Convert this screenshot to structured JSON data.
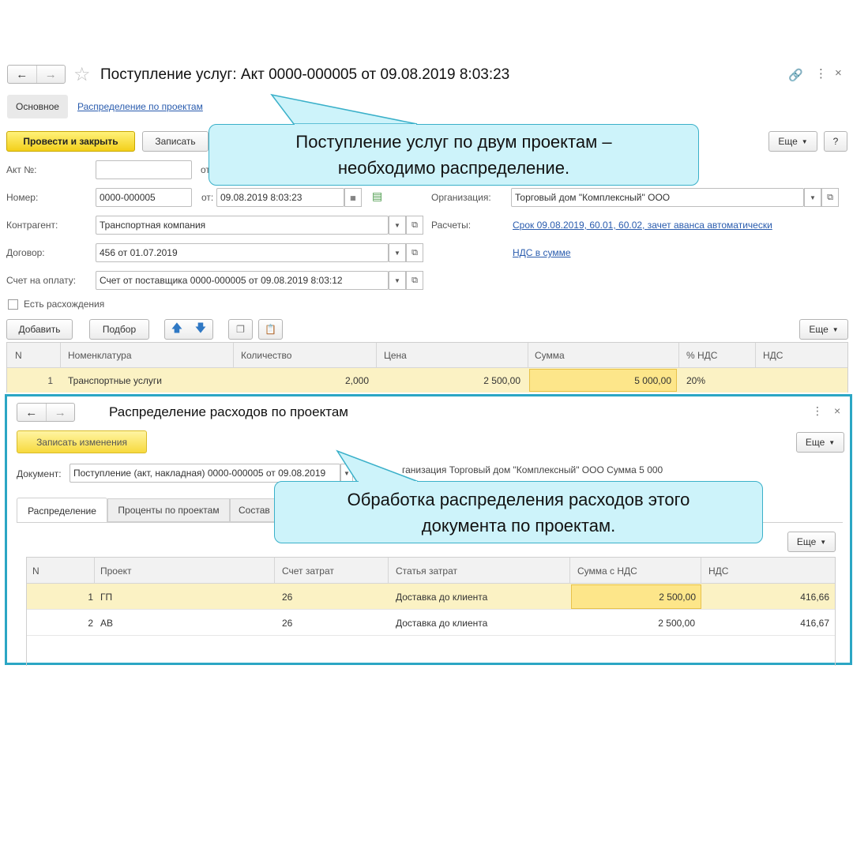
{
  "window1": {
    "title": "Поступление услуг: Акт 0000-000005 от 09.08.2019 8:03:23",
    "tabs": [
      "Основное",
      "Распределение по проектам"
    ],
    "toolbar": {
      "post_close": "Провести и закрыть",
      "save": "Записать",
      "more": "Еще",
      "help": "?"
    },
    "fields": {
      "akt_label": "Акт №:",
      "akt_value": "",
      "akt_ot": "от",
      "number_label": "Номер:",
      "number_value": "0000-000005",
      "date_label": "от:",
      "date_value": "09.08.2019  8:03:23",
      "org_label": "Организация:",
      "org_value": "Торговый дом \"Комплексный\" ООО",
      "contractor_label": "Контрагент:",
      "contractor_value": "Транспортная компания",
      "settlements_label": "Расчеты:",
      "settlements_link": "Срок 09.08.2019, 60.01, 60.02, зачет аванса автоматически",
      "contract_label": "Договор:",
      "contract_value": "456 от 01.07.2019",
      "vat_link": "НДС в сумме",
      "invoice_label": "Счет на оплату:",
      "invoice_value": "Счет от поставщика 0000-000005 от 09.08.2019 8:03:12",
      "discrepancy_label": "Есть расхождения"
    },
    "table_toolbar": {
      "add": "Добавить",
      "pick": "Подбор",
      "more": "Еще"
    },
    "table": {
      "columns": [
        "N",
        "Номенклатура",
        "Количество",
        "Цена",
        "Сумма",
        "% НДС",
        "НДС"
      ],
      "rows": [
        [
          "1",
          "Транспортные услуги",
          "2,000",
          "2 500,00",
          "5 000,00",
          "20%",
          ""
        ]
      ]
    }
  },
  "window2": {
    "title": "Распределение расходов по проектам",
    "save_changes": "Записать изменения",
    "more": "Еще",
    "doc_label": "Документ:",
    "doc_value": "Поступление (акт, накладная) 0000-000005 от 09.08.2019",
    "doc_info": "ганизация Торговый дом \"Комплексный\" ООО Сумма 5 000",
    "tabs": [
      "Распределение",
      "Проценты по проектам",
      "Состав"
    ],
    "more2": "Еще",
    "table": {
      "columns": [
        "N",
        "Проект",
        "Счет затрат",
        "Статья затрат",
        "Сумма с НДС",
        "НДС"
      ],
      "rows": [
        [
          "1",
          "ГП",
          "26",
          "Доставка до клиента",
          "2 500,00",
          "416,66"
        ],
        [
          "2",
          "АВ",
          "26",
          "Доставка до клиента",
          "2 500,00",
          "416,67"
        ]
      ]
    }
  },
  "callouts": {
    "top": "Поступление услуг по двум проектам – необходимо распределение.",
    "bottom": "Обработка распределения расходов этого документа по проектам."
  },
  "colors": {
    "accent_teal": "#2ba6c4",
    "yellow": "#f7d63a",
    "link": "#2a5cae",
    "callout_fill": "#cdf3fa"
  }
}
